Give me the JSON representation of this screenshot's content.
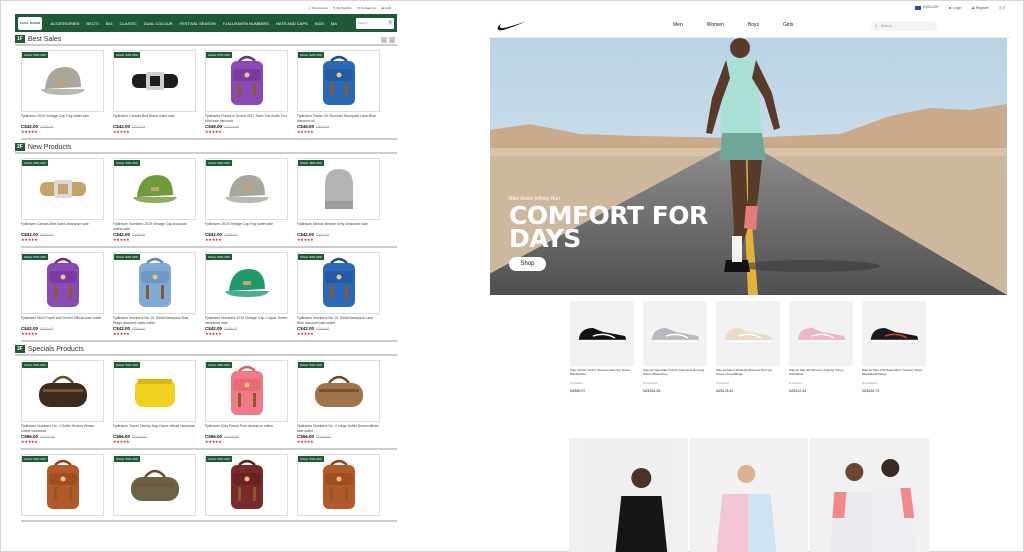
{
  "left": {
    "top_links": [
      "My Account",
      "My Wishlist",
      "Contact Us",
      "CAD"
    ],
    "logo": "FJALL RAVEN",
    "nav": [
      "ACCESSORIES",
      "BELTS",
      "BIG",
      "CLASSIC",
      "DUAL COLOUR",
      "FESTIVAL SEASON",
      "FJALLRAVEN NUMBERS",
      "HATS AND CAPS",
      "KIDS",
      "MA"
    ],
    "search_placeholder": "Search",
    "sections": [
      {
        "badge": "1F",
        "title": "Best Sales",
        "rows": [
          [
            {
              "sale": "SALE: 53% OFF",
              "name": "Fjallraven 2019 Vintage Cap Fog outlet sale",
              "price": "C$42.00",
              "old": "C$89.00",
              "img": "cap-grey"
            },
            {
              "sale": "SALE: 43% OFF",
              "name": "Fjallraven Canvas Belt Black outlet sale",
              "price": "C$42.00",
              "old": "C$73.00",
              "img": "belt-black"
            },
            {
              "sale": "SALE: 57% OFF",
              "name": "Fjallraven Purple & Orchid 2017 Save The Arctic Fox Mini sale discount",
              "price": "C$49.00",
              "old": "C$113.00",
              "img": "bag-purple"
            },
            {
              "sale": "SALE: 52% OFF",
              "name": "Fjallraven Raven 20 Shoulder Backpack Lake Blue discount uk",
              "price": "C$46.00",
              "old": "C$97.00",
              "img": "bag-blue"
            }
          ]
        ]
      },
      {
        "badge": "2F",
        "title": "New Products",
        "rows": [
          [
            {
              "sale": "SALE: 49% OFF",
              "name": "Fjallraven Canvas Belt Sand clearance sale",
              "price": "C$42.00",
              "old": "C$82.00",
              "img": "belt-sand"
            },
            {
              "sale": "SALE: 53% OFF",
              "name": "Fjallraven Numbers 2019 Vintage Cap Avocado online sale",
              "price": "C$42.00",
              "old": "C$89.00",
              "img": "cap-green"
            },
            {
              "sale": "SALE: 53% OFF",
              "name": "Fjallraven 2019 Vintage Cap Fog outlet sale",
              "price": "C$42.00",
              "old": "C$89.00",
              "img": "cap-grey"
            },
            {
              "sale": "SALE: 48% OFF",
              "name": "Fjallraven Mohair Beanie Grey clearance sale",
              "price": "C$42.00",
              "old": "C$81.00",
              "img": "beanie"
            }
          ],
          [
            {
              "sale": "SALE: 57% OFF",
              "name": "Fjallraven Mini Purple and Orchid Official sale outlet",
              "price": "C$42.00",
              "old": "C$97.00",
              "img": "bag-purple"
            },
            {
              "sale": "SALE: 53% OFF",
              "name": "Fjallraven Numbers No. 21 Small Backpack Blue Ridge discount sales outlet",
              "price": "C$42.00",
              "old": "C$89.00",
              "img": "bag-lightblue"
            },
            {
              "sale": "SALE: 53% OFF",
              "name": "Fjallraven Numbers 2019 Vintage Cap Copper Green clearance sale",
              "price": "C$42.00",
              "old": "C$89.00",
              "img": "cap-teal"
            },
            {
              "sale": "SALE: 53% OFF",
              "name": "Fjallraven Numbers No. 21 Small Backpack Lake Blue discount sale outlet",
              "price": "C$42.00",
              "old": "C$89.00",
              "img": "bag-blue"
            }
          ]
        ]
      },
      {
        "badge": "3F",
        "title": "Specials Products",
        "rows": [
          [
            {
              "sale": "SALE: 53% OFF",
              "name": "Fjallraven Numbers No. 4 Duffel Hickory Brown online clearance",
              "price": "C$56.00",
              "old": "C$119.00",
              "img": "duffel-brown"
            },
            {
              "sale": "SALE: 53% OFF",
              "name": "Fjallraven Travel Toiletry Bag Ochre official clearance",
              "price": "C$56.00",
              "old": "C$119.00",
              "img": "pouch-yellow"
            },
            {
              "sale": "SALE: 48% OFF",
              "name": "Fjallraven Kids Peach Pink clearance online",
              "price": "C$56.00",
              "old": "C$108.00",
              "img": "bag-pink"
            },
            {
              "sale": "SALE: 53% OFF",
              "name": "Fjallraven Numbers No. 4 Large Duffel Brown official sale outlet",
              "price": "C$56.00",
              "old": "C$119.00",
              "img": "duffel-tan"
            }
          ],
          [
            {
              "sale": "SALE: 53% OFF",
              "name": "",
              "price": "",
              "old": "",
              "img": "bag-rust"
            },
            {
              "sale": "SALE: 53% OFF",
              "name": "",
              "price": "",
              "old": "",
              "img": "duffel-olive"
            },
            {
              "sale": "SALE: 53% OFF",
              "name": "",
              "price": "",
              "old": "",
              "img": "bag-maroon"
            },
            {
              "sale": "SALE: 53% OFF",
              "name": "",
              "price": "",
              "old": "",
              "img": "bag-rust"
            }
          ]
        ]
      }
    ]
  },
  "right": {
    "util": {
      "lang": "ENGLISH",
      "login": "Login",
      "register": "Register",
      "cart": "0"
    },
    "menu": [
      "Men",
      "Women",
      "Boys",
      "Girls"
    ],
    "search_placeholder": "Search",
    "hero": {
      "kicker": "Nike React Infinity Run",
      "title_1": "COMFORT FOR",
      "title_2": "DAYS",
      "button": "Shop"
    },
    "shoes": [
      {
        "name": "Nike Classic Cortez Womens Running Shoes Black/White",
        "colors": "2 Colours",
        "price": "NZ$89.97",
        "color": "#111"
      },
      {
        "name": "Nike Air VaporMax Flyknit 3 Womens Running Shoes White/Grey",
        "colors": "10 Colours",
        "price": "NZ$184.28",
        "color": "#b6bac0"
      },
      {
        "name": "Nike Air Max 270 React Womens Running Shoes Cream/Beige",
        "colors": "4 Colours",
        "price": "NZ$178.43",
        "color": "#e9dcc5"
      },
      {
        "name": "Nike Air Max 90 Womens Training Shoes Pink/White",
        "colors": "5 Colours",
        "price": "NZ$112.44",
        "color": "#eeb6c6"
      },
      {
        "name": "Nike Air Max 270 React Mens Training Shoes Black/Red/Orange",
        "colors": "20 Colours",
        "price": "NZ$154.73",
        "color": "#1b1b1b"
      }
    ],
    "colors": {
      "brand": "#1f5a36",
      "star": "#dd2222"
    }
  }
}
